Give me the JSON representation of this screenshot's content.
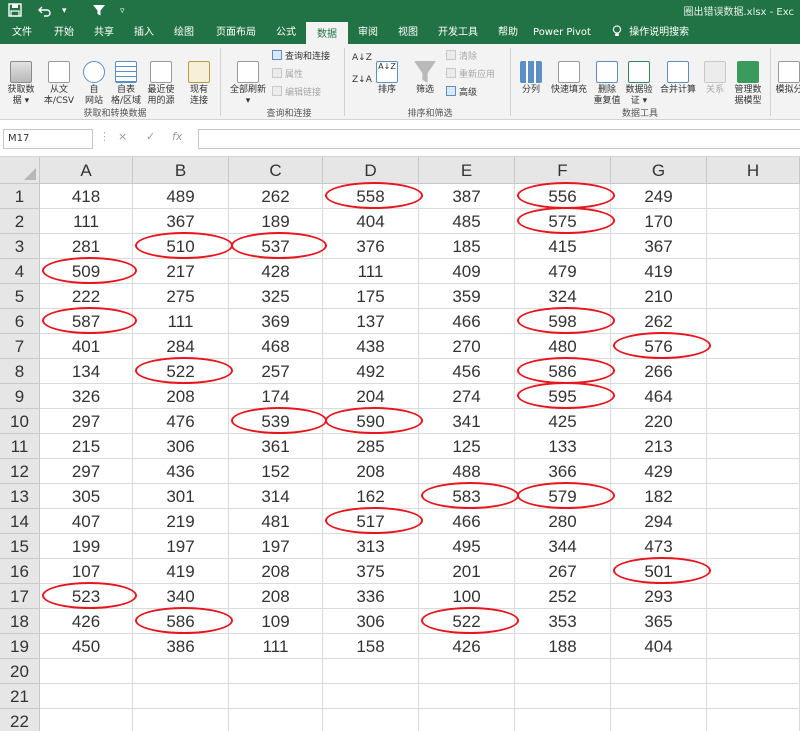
{
  "titlebar": {
    "filename": "圈出错误数据.xlsx - Exc",
    "qa_save_icon": "save-icon",
    "qa_undo_icon": "undo-icon",
    "qa_filter_icon": "filter-icon"
  },
  "tabs": [
    "文件",
    "开始",
    "共享",
    "插入",
    "绘图",
    "页面布局",
    "公式",
    "数据",
    "审阅",
    "视图",
    "开发工具",
    "帮助",
    "Power Pivot"
  ],
  "active_tab": "数据",
  "tell_me": "操作说明搜索",
  "ribbon": {
    "get_data": "获取数\n据 ▾",
    "from_csv": "从文\n本/CSV",
    "from_web": "自\n网站",
    "from_table": "自表\n格/区域",
    "recent_sources": "最近使\n用的源",
    "existing_conn": "现有\n连接",
    "group_get": "获取和转换数据",
    "refresh_all": "全部刷新\n▾",
    "queries_conn": "查询和连接",
    "properties": "属性",
    "edit_links": "编辑链接",
    "group_queries": "查询和连接",
    "sort_az": "A↓Z",
    "sort": "排序",
    "filter": "筛选",
    "clear": "清除",
    "reapply": "重新应用",
    "advanced": "高级",
    "group_sort": "排序和筛选",
    "text_to_cols": "分列",
    "flash_fill": "快速填充",
    "remove_dup": "删除\n重复值",
    "data_validation": "数据验\n证 ▾",
    "consolidate": "合并计算",
    "relationships": "关系",
    "manage_model": "管理数\n据模型",
    "group_tools": "数据工具",
    "what_if": "模拟分"
  },
  "formula_bar": {
    "name_box": "M17",
    "cancel_icon": "×",
    "enter_icon": "✓",
    "fx_icon": "fx",
    "formula": ""
  },
  "columns": [
    "A",
    "B",
    "C",
    "D",
    "E",
    "F",
    "G",
    "H"
  ],
  "rows": [
    [
      "418",
      "489",
      "262",
      "558",
      "387",
      "556",
      "249",
      ""
    ],
    [
      "111",
      "367",
      "189",
      "404",
      "485",
      "575",
      "170",
      ""
    ],
    [
      "281",
      "510",
      "537",
      "376",
      "185",
      "415",
      "367",
      ""
    ],
    [
      "509",
      "217",
      "428",
      "111",
      "409",
      "479",
      "419",
      ""
    ],
    [
      "222",
      "275",
      "325",
      "175",
      "359",
      "324",
      "210",
      ""
    ],
    [
      "587",
      "111",
      "369",
      "137",
      "466",
      "598",
      "262",
      ""
    ],
    [
      "401",
      "284",
      "468",
      "438",
      "270",
      "480",
      "576",
      ""
    ],
    [
      "134",
      "522",
      "257",
      "492",
      "456",
      "586",
      "266",
      ""
    ],
    [
      "326",
      "208",
      "174",
      "204",
      "274",
      "595",
      "464",
      ""
    ],
    [
      "297",
      "476",
      "539",
      "590",
      "341",
      "425",
      "220",
      ""
    ],
    [
      "215",
      "306",
      "361",
      "285",
      "125",
      "133",
      "213",
      ""
    ],
    [
      "297",
      "436",
      "152",
      "208",
      "488",
      "366",
      "429",
      ""
    ],
    [
      "305",
      "301",
      "314",
      "162",
      "583",
      "579",
      "182",
      ""
    ],
    [
      "407",
      "219",
      "481",
      "517",
      "466",
      "280",
      "294",
      ""
    ],
    [
      "199",
      "197",
      "197",
      "313",
      "495",
      "344",
      "473",
      ""
    ],
    [
      "107",
      "419",
      "208",
      "375",
      "201",
      "267",
      "501",
      ""
    ],
    [
      "523",
      "340",
      "208",
      "336",
      "100",
      "252",
      "293",
      ""
    ],
    [
      "426",
      "586",
      "109",
      "306",
      "522",
      "353",
      "365",
      ""
    ],
    [
      "450",
      "386",
      "111",
      "158",
      "426",
      "188",
      "404",
      ""
    ],
    [
      "",
      "",
      "",
      "",
      "",
      "",
      "",
      ""
    ],
    [
      "",
      "",
      "",
      "",
      "",
      "",
      "",
      ""
    ],
    [
      "",
      "",
      "",
      "",
      "",
      "",
      "",
      ""
    ]
  ],
  "validation_threshold": 500,
  "circle_color": "#e8141e",
  "accent_color": "#217346"
}
